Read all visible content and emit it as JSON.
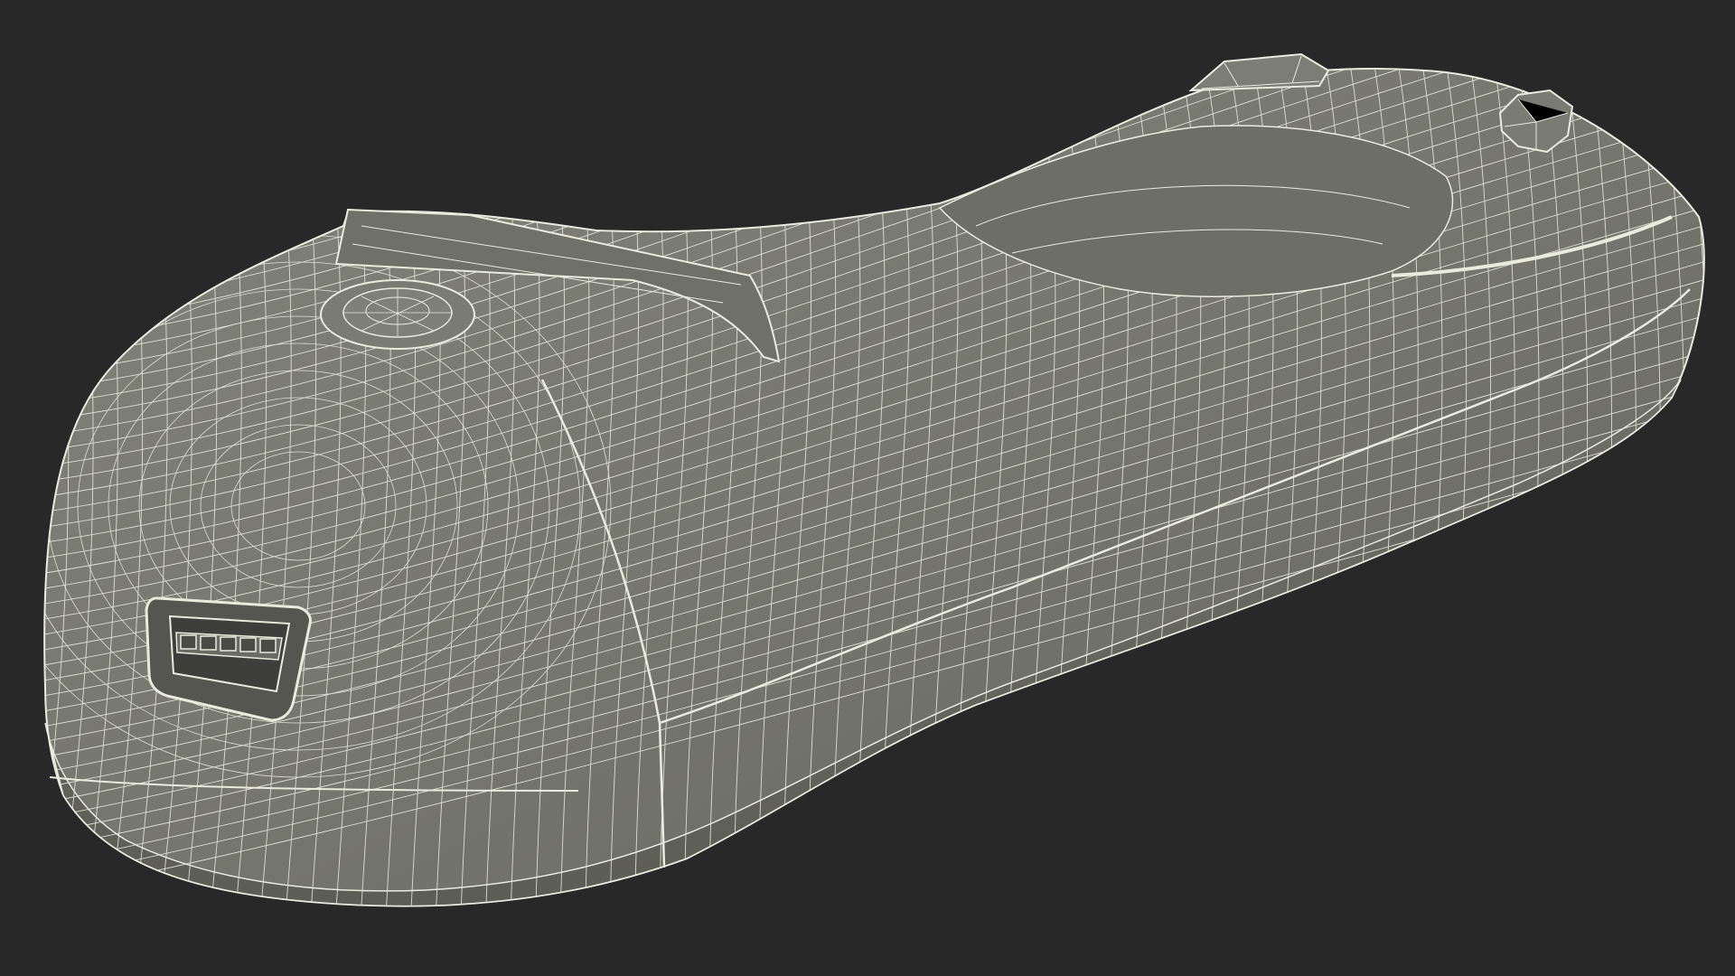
{
  "scene": {
    "background": "#282828",
    "subject": "wireframe-3d-model",
    "shading": {
      "fill": "#74756c",
      "fill_dark": "#5f6058",
      "fill_light": "#82837a",
      "wire": "#e9ebdf"
    },
    "parts": [
      "body-shell",
      "base-rim",
      "usb-port",
      "top-fin",
      "round-button",
      "rear-knob",
      "rear-nub",
      "grip-panel"
    ]
  }
}
